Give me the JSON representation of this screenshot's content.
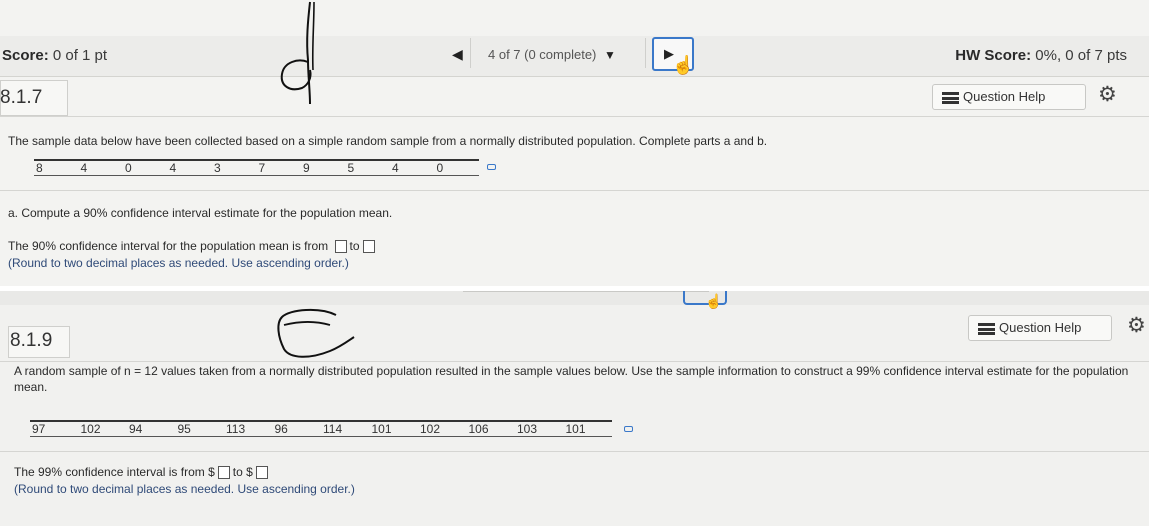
{
  "top_question": {
    "score_label": "Score:",
    "score_value": "0 of 1 pt",
    "nav_position": "4 of 7 (0 complete)",
    "hw_score_label": "HW Score:",
    "hw_score_value": "0%, 0 of 7 pts",
    "number": "8.1.7",
    "help_label": "Question Help",
    "intro": "The sample data below have been collected based on a simple random sample from a normally distributed population. Complete parts a and b.",
    "data": [
      "8",
      "4",
      "0",
      "4",
      "3",
      "7",
      "9",
      "5",
      "4",
      "0"
    ],
    "part_a": "a. Compute a 90% confidence interval estimate for the population mean.",
    "answer_prefix": "The 90% confidence interval for the population mean is from",
    "answer_to": "to",
    "note": "(Round to two decimal places as needed. Use ascending order.)"
  },
  "bottom_question": {
    "number": "8.1.9",
    "help_label": "Question Help",
    "intro": "A random sample of n = 12 values taken from a normally distributed population resulted in the sample values below. Use the sample information to construct a 99% confidence interval estimate for the population mean.",
    "data": [
      "97",
      "102",
      "94",
      "95",
      "113",
      "96",
      "114",
      "101",
      "102",
      "106",
      "103",
      "101"
    ],
    "answer_prefix": "The 99% confidence interval is from $",
    "answer_to": "to $",
    "note": "(Round to two decimal places as needed. Use ascending order.)"
  },
  "icons": {
    "prev": "triangle-left-icon",
    "dropdown": "triangle-down-icon",
    "next": "triangle-right-icon",
    "help": "list-icon",
    "settings": "gear-icon",
    "copy": "copy-data-icon"
  },
  "colors": {
    "accent_blue": "#3a78c9",
    "note_blue": "#2f4a78"
  }
}
